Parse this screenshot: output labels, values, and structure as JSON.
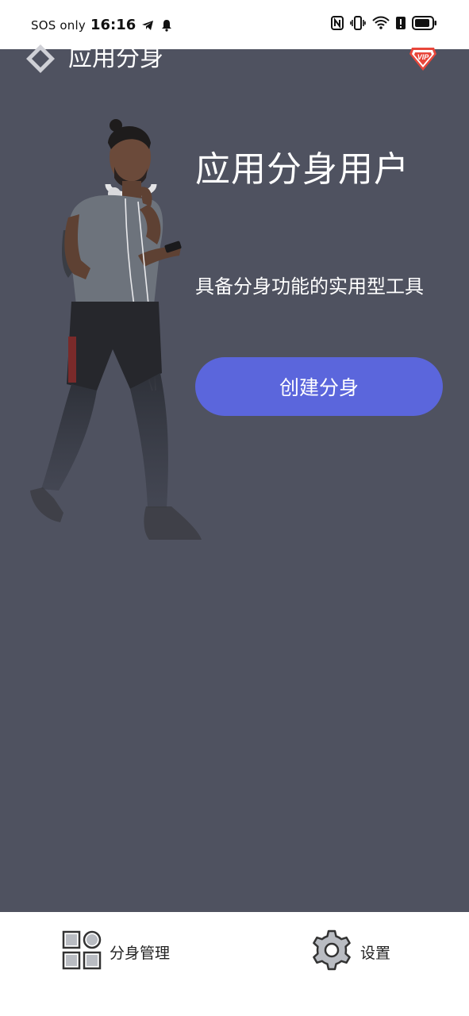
{
  "status_bar": {
    "carrier": "SOS only",
    "time": "16:16",
    "icons": [
      "telegram-icon",
      "bell-icon",
      "nfc-icon",
      "vibrate-icon",
      "wifi-icon",
      "alert-icon",
      "battery-icon"
    ]
  },
  "header": {
    "title": "应用分身",
    "logo_icon": "diamond-logo-icon",
    "vip_icon": "vip-badge-icon"
  },
  "hero": {
    "title": "应用分身用户",
    "subtitle": "具备分身功能的实用型工具",
    "create_button_label": "创建分身"
  },
  "bottom_nav": {
    "items": [
      {
        "label": "分身管理",
        "icon": "grid-apps-icon"
      },
      {
        "label": "设置",
        "icon": "gear-icon"
      }
    ]
  },
  "colors": {
    "background": "#4f5260",
    "button": "#5b66dc",
    "vip": "#e8463a"
  }
}
